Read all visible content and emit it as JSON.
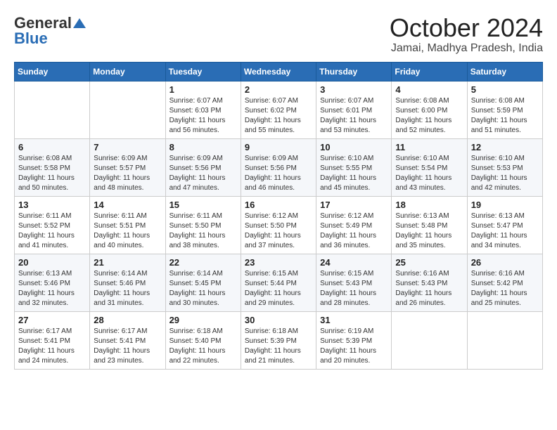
{
  "logo": {
    "general": "General",
    "blue": "Blue"
  },
  "header": {
    "month": "October 2024",
    "location": "Jamai, Madhya Pradesh, India"
  },
  "weekdays": [
    "Sunday",
    "Monday",
    "Tuesday",
    "Wednesday",
    "Thursday",
    "Friday",
    "Saturday"
  ],
  "weeks": [
    [
      {
        "day": "",
        "detail": ""
      },
      {
        "day": "",
        "detail": ""
      },
      {
        "day": "1",
        "detail": "Sunrise: 6:07 AM\nSunset: 6:03 PM\nDaylight: 11 hours and 56 minutes."
      },
      {
        "day": "2",
        "detail": "Sunrise: 6:07 AM\nSunset: 6:02 PM\nDaylight: 11 hours and 55 minutes."
      },
      {
        "day": "3",
        "detail": "Sunrise: 6:07 AM\nSunset: 6:01 PM\nDaylight: 11 hours and 53 minutes."
      },
      {
        "day": "4",
        "detail": "Sunrise: 6:08 AM\nSunset: 6:00 PM\nDaylight: 11 hours and 52 minutes."
      },
      {
        "day": "5",
        "detail": "Sunrise: 6:08 AM\nSunset: 5:59 PM\nDaylight: 11 hours and 51 minutes."
      }
    ],
    [
      {
        "day": "6",
        "detail": "Sunrise: 6:08 AM\nSunset: 5:58 PM\nDaylight: 11 hours and 50 minutes."
      },
      {
        "day": "7",
        "detail": "Sunrise: 6:09 AM\nSunset: 5:57 PM\nDaylight: 11 hours and 48 minutes."
      },
      {
        "day": "8",
        "detail": "Sunrise: 6:09 AM\nSunset: 5:56 PM\nDaylight: 11 hours and 47 minutes."
      },
      {
        "day": "9",
        "detail": "Sunrise: 6:09 AM\nSunset: 5:56 PM\nDaylight: 11 hours and 46 minutes."
      },
      {
        "day": "10",
        "detail": "Sunrise: 6:10 AM\nSunset: 5:55 PM\nDaylight: 11 hours and 45 minutes."
      },
      {
        "day": "11",
        "detail": "Sunrise: 6:10 AM\nSunset: 5:54 PM\nDaylight: 11 hours and 43 minutes."
      },
      {
        "day": "12",
        "detail": "Sunrise: 6:10 AM\nSunset: 5:53 PM\nDaylight: 11 hours and 42 minutes."
      }
    ],
    [
      {
        "day": "13",
        "detail": "Sunrise: 6:11 AM\nSunset: 5:52 PM\nDaylight: 11 hours and 41 minutes."
      },
      {
        "day": "14",
        "detail": "Sunrise: 6:11 AM\nSunset: 5:51 PM\nDaylight: 11 hours and 40 minutes."
      },
      {
        "day": "15",
        "detail": "Sunrise: 6:11 AM\nSunset: 5:50 PM\nDaylight: 11 hours and 38 minutes."
      },
      {
        "day": "16",
        "detail": "Sunrise: 6:12 AM\nSunset: 5:50 PM\nDaylight: 11 hours and 37 minutes."
      },
      {
        "day": "17",
        "detail": "Sunrise: 6:12 AM\nSunset: 5:49 PM\nDaylight: 11 hours and 36 minutes."
      },
      {
        "day": "18",
        "detail": "Sunrise: 6:13 AM\nSunset: 5:48 PM\nDaylight: 11 hours and 35 minutes."
      },
      {
        "day": "19",
        "detail": "Sunrise: 6:13 AM\nSunset: 5:47 PM\nDaylight: 11 hours and 34 minutes."
      }
    ],
    [
      {
        "day": "20",
        "detail": "Sunrise: 6:13 AM\nSunset: 5:46 PM\nDaylight: 11 hours and 32 minutes."
      },
      {
        "day": "21",
        "detail": "Sunrise: 6:14 AM\nSunset: 5:46 PM\nDaylight: 11 hours and 31 minutes."
      },
      {
        "day": "22",
        "detail": "Sunrise: 6:14 AM\nSunset: 5:45 PM\nDaylight: 11 hours and 30 minutes."
      },
      {
        "day": "23",
        "detail": "Sunrise: 6:15 AM\nSunset: 5:44 PM\nDaylight: 11 hours and 29 minutes."
      },
      {
        "day": "24",
        "detail": "Sunrise: 6:15 AM\nSunset: 5:43 PM\nDaylight: 11 hours and 28 minutes."
      },
      {
        "day": "25",
        "detail": "Sunrise: 6:16 AM\nSunset: 5:43 PM\nDaylight: 11 hours and 26 minutes."
      },
      {
        "day": "26",
        "detail": "Sunrise: 6:16 AM\nSunset: 5:42 PM\nDaylight: 11 hours and 25 minutes."
      }
    ],
    [
      {
        "day": "27",
        "detail": "Sunrise: 6:17 AM\nSunset: 5:41 PM\nDaylight: 11 hours and 24 minutes."
      },
      {
        "day": "28",
        "detail": "Sunrise: 6:17 AM\nSunset: 5:41 PM\nDaylight: 11 hours and 23 minutes."
      },
      {
        "day": "29",
        "detail": "Sunrise: 6:18 AM\nSunset: 5:40 PM\nDaylight: 11 hours and 22 minutes."
      },
      {
        "day": "30",
        "detail": "Sunrise: 6:18 AM\nSunset: 5:39 PM\nDaylight: 11 hours and 21 minutes."
      },
      {
        "day": "31",
        "detail": "Sunrise: 6:19 AM\nSunset: 5:39 PM\nDaylight: 11 hours and 20 minutes."
      },
      {
        "day": "",
        "detail": ""
      },
      {
        "day": "",
        "detail": ""
      }
    ]
  ]
}
